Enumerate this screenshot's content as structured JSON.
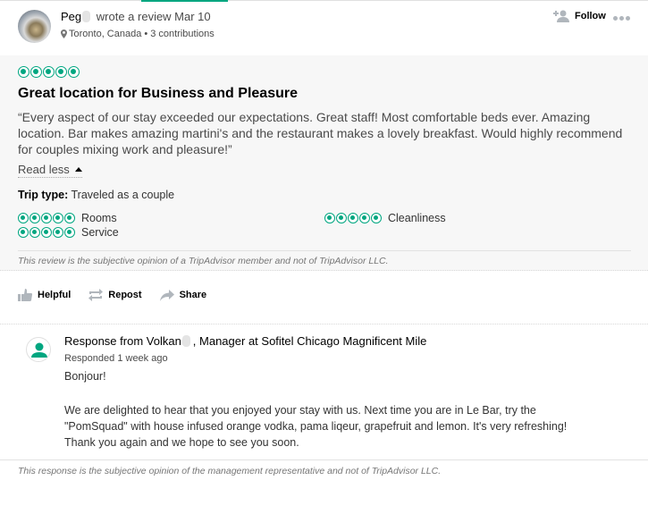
{
  "header": {
    "reviewer_name": "Peg",
    "action_text": "wrote a review Mar 10",
    "location": "Toronto, Canada",
    "separator": "•",
    "contributions": "3 contributions",
    "follow_label": "Follow"
  },
  "review": {
    "rating": 5,
    "rating_max": 5,
    "title": "Great location for Business and Pleasure",
    "text": "“Every aspect of our stay exceeded our expectations. Great staff! Most comfortable beds ever. Amazing location. Bar makes amazing martini's and the restaurant makes a lovely breakfast. Would highly recommend for couples mixing work and pleasure!”",
    "read_less_label": "Read less",
    "trip_type_label": "Trip type:",
    "trip_type_value": "Traveled as a couple",
    "sub_ratings": [
      {
        "label": "Rooms",
        "rating": 5
      },
      {
        "label": "Cleanliness",
        "rating": 5
      },
      {
        "label": "Service",
        "rating": 5
      }
    ],
    "disclaimer": "This review is the subjective opinion of a TripAdvisor member and not of TripAdvisor LLC."
  },
  "actions": {
    "helpful_label": "Helpful",
    "repost_label": "Repost",
    "share_label": "Share"
  },
  "response": {
    "prefix": "Response from Volkan",
    "suffix": ", Manager at Sofitel Chicago Magnificent Mile",
    "time": "Responded 1 week ago",
    "greeting": "Bonjour!",
    "text": "We are delighted to hear that you enjoyed your stay with us. Next time you are in Le Bar, try the \"PomSquad\" with house infused orange vodka, pama liqeur, grapefruit and lemon. It's very refreshing! Thank you again and we hope to see you soon.",
    "disclaimer": "This response is the subjective opinion of the management representative and not of TripAdvisor LLC."
  },
  "colors": {
    "accent": "#00a680",
    "icon_gray": "#b0b6bc",
    "panel_bg": "#f7f7f7"
  }
}
